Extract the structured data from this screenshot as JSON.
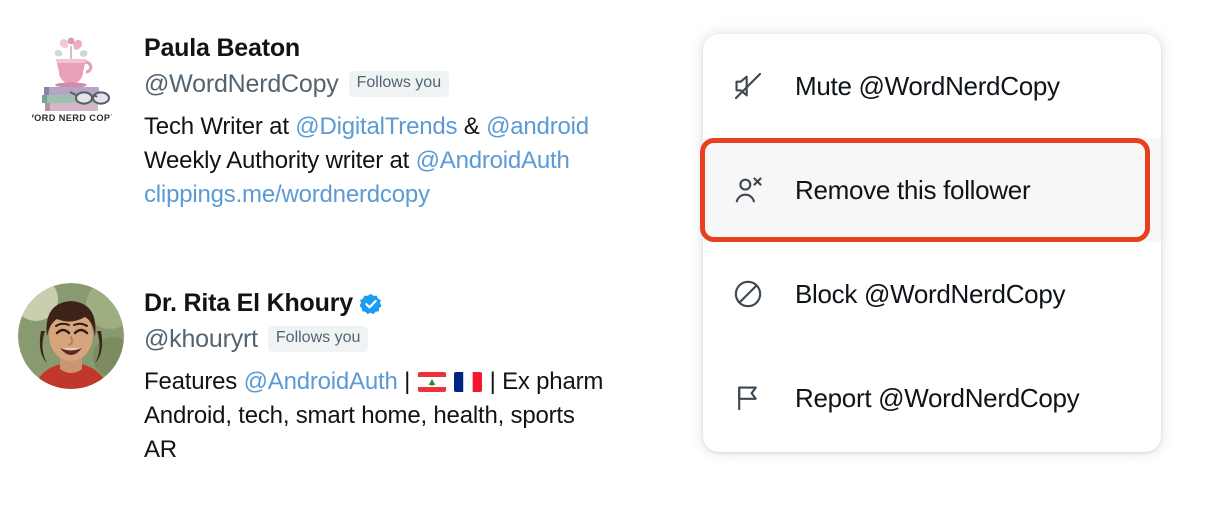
{
  "profiles": [
    {
      "display_name": "Paula Beaton",
      "handle": "@WordNerdCopy",
      "follows_you_label": "Follows you",
      "verified": false,
      "avatar_name": "word-nerd-copy-logo",
      "avatar_caption": "WORD NERD COPY",
      "bio_lines": [
        {
          "segments": [
            {
              "text": "Tech Writer at ",
              "type": "plain"
            },
            {
              "text": "@DigitalTrends",
              "type": "mention"
            },
            {
              "text": " & ",
              "type": "plain"
            },
            {
              "text": "@android",
              "type": "mention"
            }
          ]
        },
        {
          "segments": [
            {
              "text": "Weekly Authority writer at ",
              "type": "plain"
            },
            {
              "text": "@AndroidAuth",
              "type": "mention"
            }
          ]
        },
        {
          "segments": [
            {
              "text": "clippings.me/wordnerdcopy",
              "type": "url"
            }
          ]
        }
      ]
    },
    {
      "display_name": "Dr. Rita El Khoury",
      "handle": "@khouryrt",
      "follows_you_label": "Follows you",
      "verified": true,
      "avatar_name": "rita-el-khoury-photo",
      "avatar_caption": "",
      "bio_lines": [
        {
          "segments": [
            {
              "text": "Features ",
              "type": "plain"
            },
            {
              "text": "@AndroidAuth",
              "type": "mention"
            },
            {
              "text": " | ",
              "type": "plain"
            },
            {
              "text": "lebanon-flag",
              "type": "flag-lb"
            },
            {
              "text": " ",
              "type": "plain"
            },
            {
              "text": "france-flag",
              "type": "flag-fr"
            },
            {
              "text": " | Ex pharm",
              "type": "plain"
            }
          ]
        },
        {
          "segments": [
            {
              "text": "Android, tech, smart home, health, sports",
              "type": "plain"
            }
          ]
        },
        {
          "segments": [
            {
              "text": "AR",
              "type": "plain"
            }
          ]
        }
      ]
    }
  ],
  "menu": {
    "items": [
      {
        "label": "Mute @WordNerdCopy",
        "icon": "mute-icon",
        "highlighted": false
      },
      {
        "label": "Remove this follower",
        "icon": "person-remove-icon",
        "highlighted": true
      },
      {
        "label": "Block @WordNerdCopy",
        "icon": "block-icon",
        "highlighted": false
      },
      {
        "label": "Report @WordNerdCopy",
        "icon": "flag-icon",
        "highlighted": false
      }
    ]
  },
  "colors": {
    "highlight_ring": "#e8401f",
    "link": "#5b9bd5",
    "text_primary": "#0f1419",
    "text_secondary": "#536471",
    "badge_bg": "#eff3f4",
    "verified_blue": "#1d9bf0",
    "row_highlight_bg": "#f7f7f7"
  }
}
